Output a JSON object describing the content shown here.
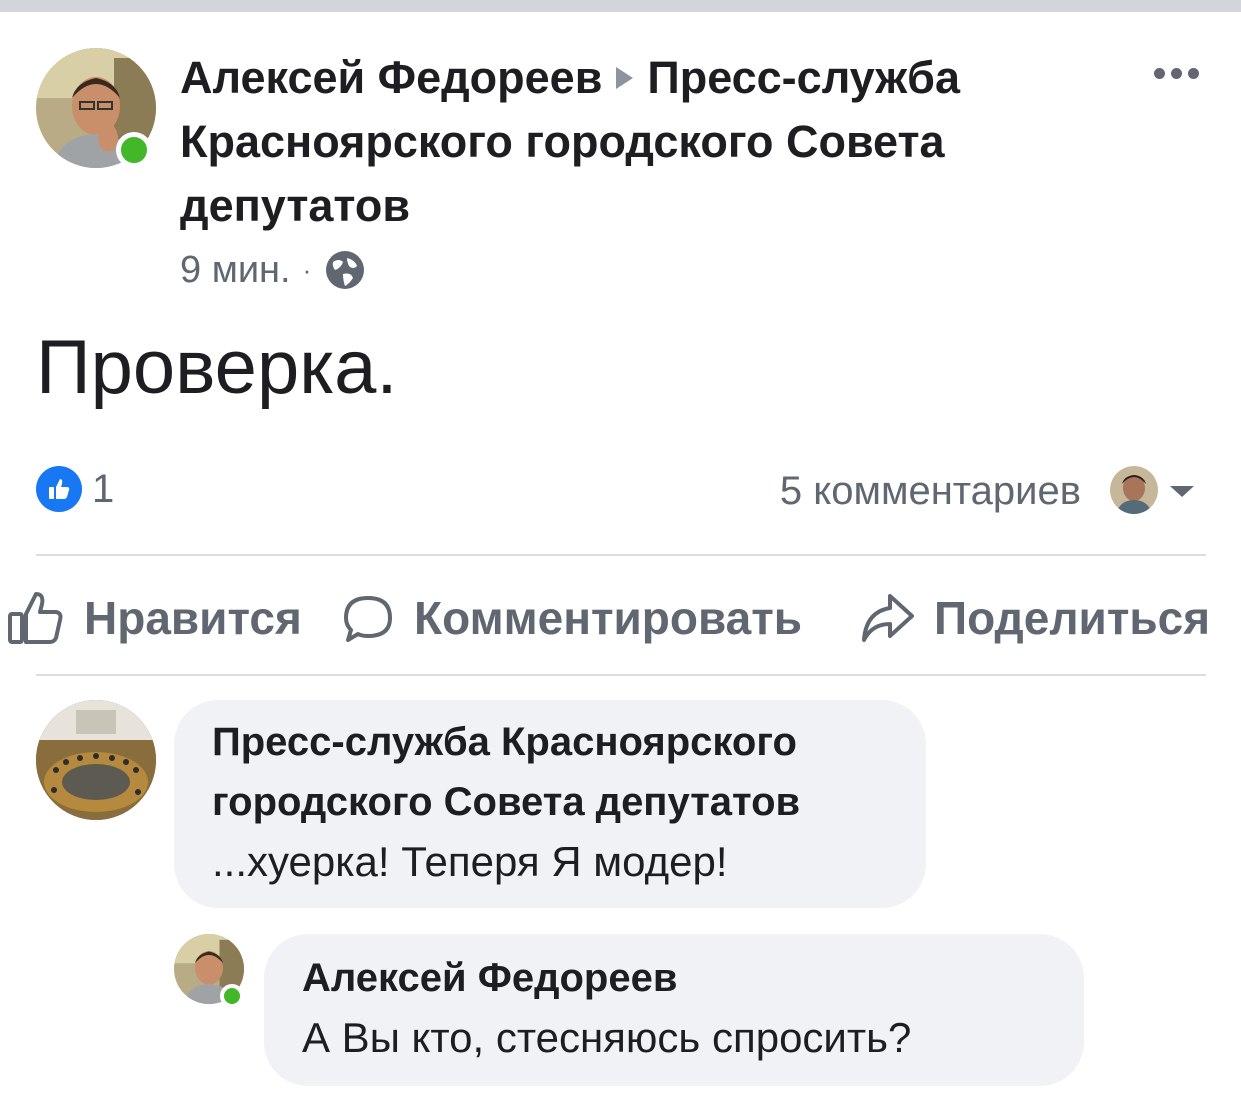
{
  "post": {
    "author": "Алексей Федореев",
    "target_line1": "Пресс-служба",
    "target_line2": "Красноярского городского Совета",
    "target_line3": "депутатов",
    "time": "9 мин.",
    "separator": "·",
    "privacy_icon": "globe-icon",
    "text": "Проверка.",
    "likes_count": "1",
    "comments_count": "5 комментариев"
  },
  "actions": {
    "like_label": "Нравится",
    "comment_label": "Комментировать",
    "share_label": "Поделиться"
  },
  "comments": [
    {
      "author_line1": "Пресс-служба Красноярского",
      "author_line2": "городского Совета депутатов",
      "text": "...хуерка! Теперя Я модер!"
    },
    {
      "author": "Алексей Федореев",
      "text": "А Вы кто, стесняюсь спросить?"
    }
  ],
  "colors": {
    "accent": "#1877f2",
    "online": "#42b72a",
    "muted": "#606770",
    "bubble": "#f0f2f5"
  }
}
